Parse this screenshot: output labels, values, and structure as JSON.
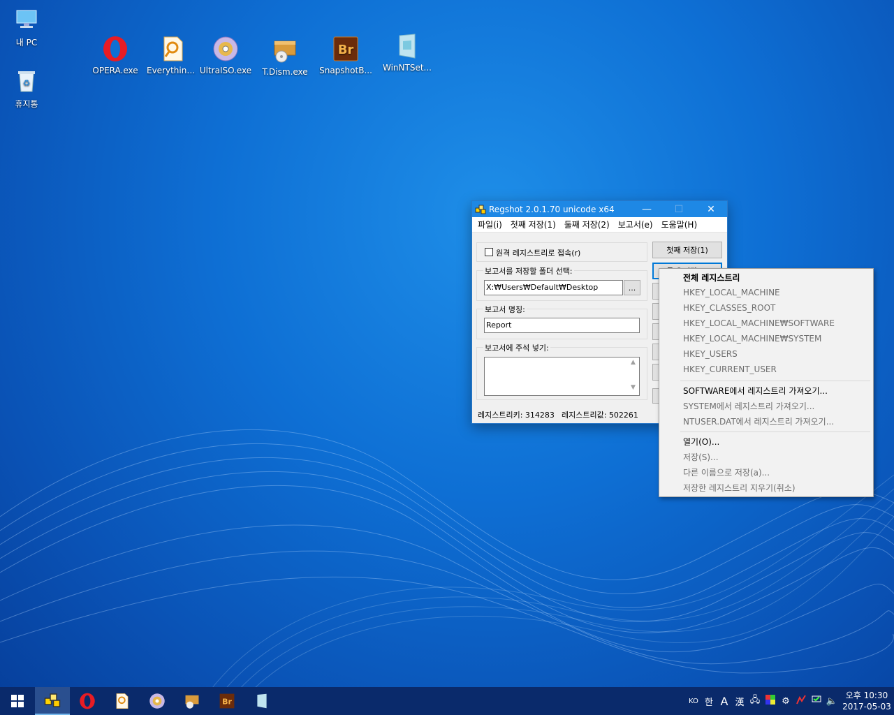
{
  "desktop": {
    "icons": [
      {
        "label": "내 PC"
      },
      {
        "label": "휴지통"
      },
      {
        "label": "OPERA.exe"
      },
      {
        "label": "Everything...."
      },
      {
        "label": "UltraISO.exe"
      },
      {
        "label": "T.Dism.exe"
      },
      {
        "label": "SnapshotB..."
      },
      {
        "label": "WinNTSet..."
      }
    ]
  },
  "window": {
    "title": "Regshot 2.0.1.70 unicode x64",
    "controls": {
      "minimize": "—",
      "maximize": "☐",
      "close": "✕"
    },
    "menu": [
      "파일(i)",
      "첫째 저장(1)",
      "둘째 저장(2)",
      "보고서(e)",
      "도움말(H)"
    ],
    "remote_checkbox_label": "원격 레지스트리로 접속(r)",
    "folder_label": "보고서를 저장할 폴더 선택:",
    "folder_value": "X:₩Users₩Default₩Desktop",
    "browse_label": "...",
    "report_name_label": "보고서 명칭:",
    "report_name_value": "Report",
    "comment_label": "보고서에 주석 넣기:",
    "buttons": {
      "first_save": "첫째 저장(1)",
      "second_save": "둘째 저장(2)"
    },
    "status": {
      "keys": "레지스트리키: 314283",
      "values": "레지스트리값: 502261"
    }
  },
  "context_menu": {
    "items": [
      {
        "label": "전체 레지스트리",
        "style": "bold"
      },
      {
        "label": "HKEY_LOCAL_MACHINE",
        "style": "disabled"
      },
      {
        "label": "HKEY_CLASSES_ROOT",
        "style": "disabled"
      },
      {
        "label": "HKEY_LOCAL_MACHINE₩SOFTWARE",
        "style": "disabled"
      },
      {
        "label": "HKEY_LOCAL_MACHINE₩SYSTEM",
        "style": "disabled"
      },
      {
        "label": "HKEY_USERS",
        "style": "disabled"
      },
      {
        "label": "HKEY_CURRENT_USER",
        "style": "disabled"
      },
      {
        "label": "SOFTWARE에서 레지스트리 가져오기...",
        "style": "normal"
      },
      {
        "label": "SYSTEM에서 레지스트리 가져오기...",
        "style": "disabled"
      },
      {
        "label": "NTUSER.DAT에서 레지스트리 가져오기...",
        "style": "disabled"
      },
      {
        "label": "열기(O)...",
        "style": "normal"
      },
      {
        "label": "저장(S)...",
        "style": "disabled"
      },
      {
        "label": "다른 이름으로 저장(a)...",
        "style": "disabled"
      },
      {
        "label": "저장한 레지스트리 지우기(취소)",
        "style": "disabled"
      }
    ]
  },
  "taskbar": {
    "tray": {
      "lang": "KO",
      "ime_hangul": "한",
      "ime_a": "A",
      "ime_hanja": "漢"
    },
    "clock": {
      "time": "오후 10:30",
      "date": "2017-05-03"
    }
  },
  "colors": {
    "accent": "#1e88e5",
    "taskbar": "#0a2a6b",
    "desktop": "#0e6fd4"
  }
}
